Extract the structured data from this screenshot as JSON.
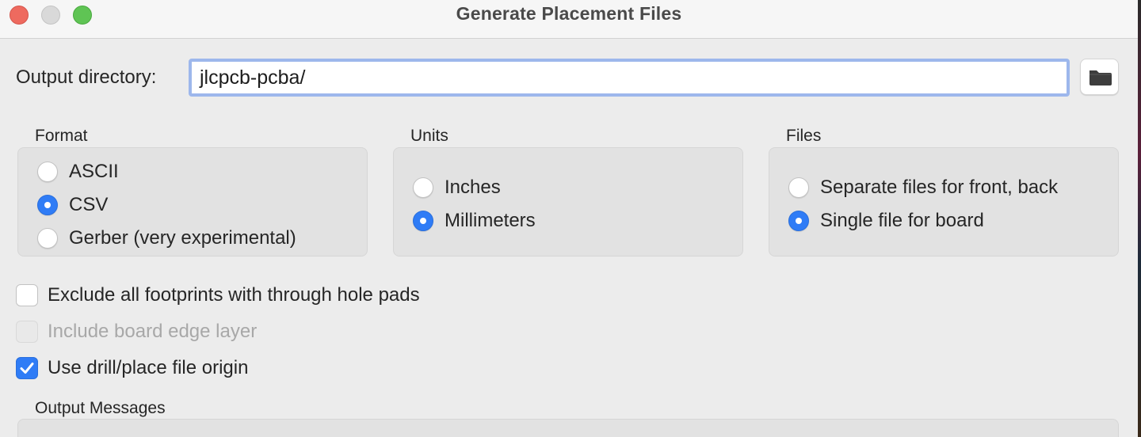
{
  "window": {
    "title": "Generate Placement Files"
  },
  "output_directory": {
    "label": "Output directory:",
    "value": "jlcpcb-pcba/",
    "browse_icon": "folder-icon"
  },
  "format": {
    "title": "Format",
    "options": [
      {
        "label": "ASCII",
        "selected": false
      },
      {
        "label": "CSV",
        "selected": true
      },
      {
        "label": "Gerber (very experimental)",
        "selected": false
      }
    ]
  },
  "units": {
    "title": "Units",
    "options": [
      {
        "label": "Inches",
        "selected": false
      },
      {
        "label": "Millimeters",
        "selected": true
      }
    ]
  },
  "files": {
    "title": "Files",
    "options": [
      {
        "label": "Separate files for front, back",
        "selected": false
      },
      {
        "label": "Single file for board",
        "selected": true
      }
    ]
  },
  "options": {
    "exclude_th": {
      "label": "Exclude all footprints with through hole pads",
      "checked": false,
      "enabled": true
    },
    "include_edge": {
      "label": "Include board edge layer",
      "checked": false,
      "enabled": false
    },
    "use_origin": {
      "label": "Use drill/place file origin",
      "checked": true,
      "enabled": true
    }
  },
  "output_messages": {
    "title": "Output Messages"
  },
  "colors": {
    "accent": "#2f7cf6",
    "focus_ring": "#9db7ec",
    "window_bg": "#ececec"
  }
}
